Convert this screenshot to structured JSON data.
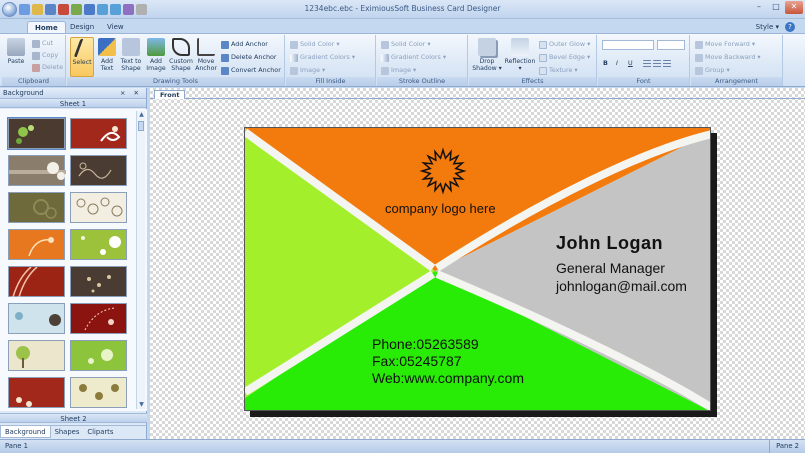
{
  "window": {
    "title": "1234ebc.ebc - EximiousSoft Business Card Designer",
    "minimize": "–",
    "maximize": "□",
    "close": "✕"
  },
  "tabs": [
    {
      "label": "Home",
      "active": true
    },
    {
      "label": "Design",
      "active": false
    },
    {
      "label": "View",
      "active": false
    }
  ],
  "style_menu": "Style ▾",
  "help": "?",
  "ribbon": {
    "clipboard": {
      "label": "Clipboard",
      "paste": "Paste",
      "cut": "Cut",
      "copy": "Copy",
      "delete": "Delete"
    },
    "drawing_tools": {
      "label": "Drawing Tools",
      "select": "Select",
      "add_text": "Add Text",
      "text_to_shape": "Text to Shape",
      "add_image": "Add Image",
      "custom_shape": "Custom Shape",
      "move_anchor": "Move Anchor",
      "add_anchor": "Add Anchor",
      "delete_anchor": "Delete Anchor",
      "convert_anchor": "Convert Anchor"
    },
    "fill_inside": {
      "label": "Fill Inside",
      "solid": "Solid Color ▾",
      "gradient": "Gradient Colors ▾",
      "image": "Image ▾"
    },
    "stroke_outline": {
      "label": "Stroke Outline",
      "solid": "Solid Color ▾",
      "gradient": "Gradient Colors ▾",
      "image": "Image ▾"
    },
    "effects": {
      "label": "Effects",
      "drop_shadow": "Drop Shadow ▾",
      "reflection": "Reflection ▾",
      "outer_glow": "Outer Glow ▾",
      "bevel_edge": "Bevel Edge ▾",
      "texture": "Texture ▾"
    },
    "font": {
      "label": "Font",
      "bold": "B",
      "italic": "I",
      "underline": "U"
    },
    "arrangement": {
      "label": "Arrangement",
      "move_forward": "Move Forward ▾",
      "move_backward": "Move Backward ▾",
      "group": "Group ▾"
    }
  },
  "left_pane": {
    "title": "Background",
    "controls": "⨯ ✕",
    "sheet1": "Sheet 1",
    "sheet2": "Sheet 2",
    "bottom_tabs": [
      {
        "label": "Background",
        "active": true
      },
      {
        "label": "Shapes",
        "active": false
      },
      {
        "label": "Cliparts",
        "active": false
      }
    ]
  },
  "document_tab": "Front",
  "card": {
    "logo_text": "company logo here",
    "name": "John Logan",
    "job_title": "General Manager",
    "email": "johnlogan@mail.com",
    "phone": "Phone:05263589",
    "fax": "Fax:05245787",
    "web": "Web:www.company.com",
    "colors": {
      "orange": "#f37a0c",
      "lime": "#a4ef2c",
      "gray": "#c4c4c4",
      "green": "#29ec06",
      "stripe": "#f4f4f0"
    }
  },
  "status": {
    "pane1": "Pane 1",
    "pane2": "Pane 2"
  }
}
